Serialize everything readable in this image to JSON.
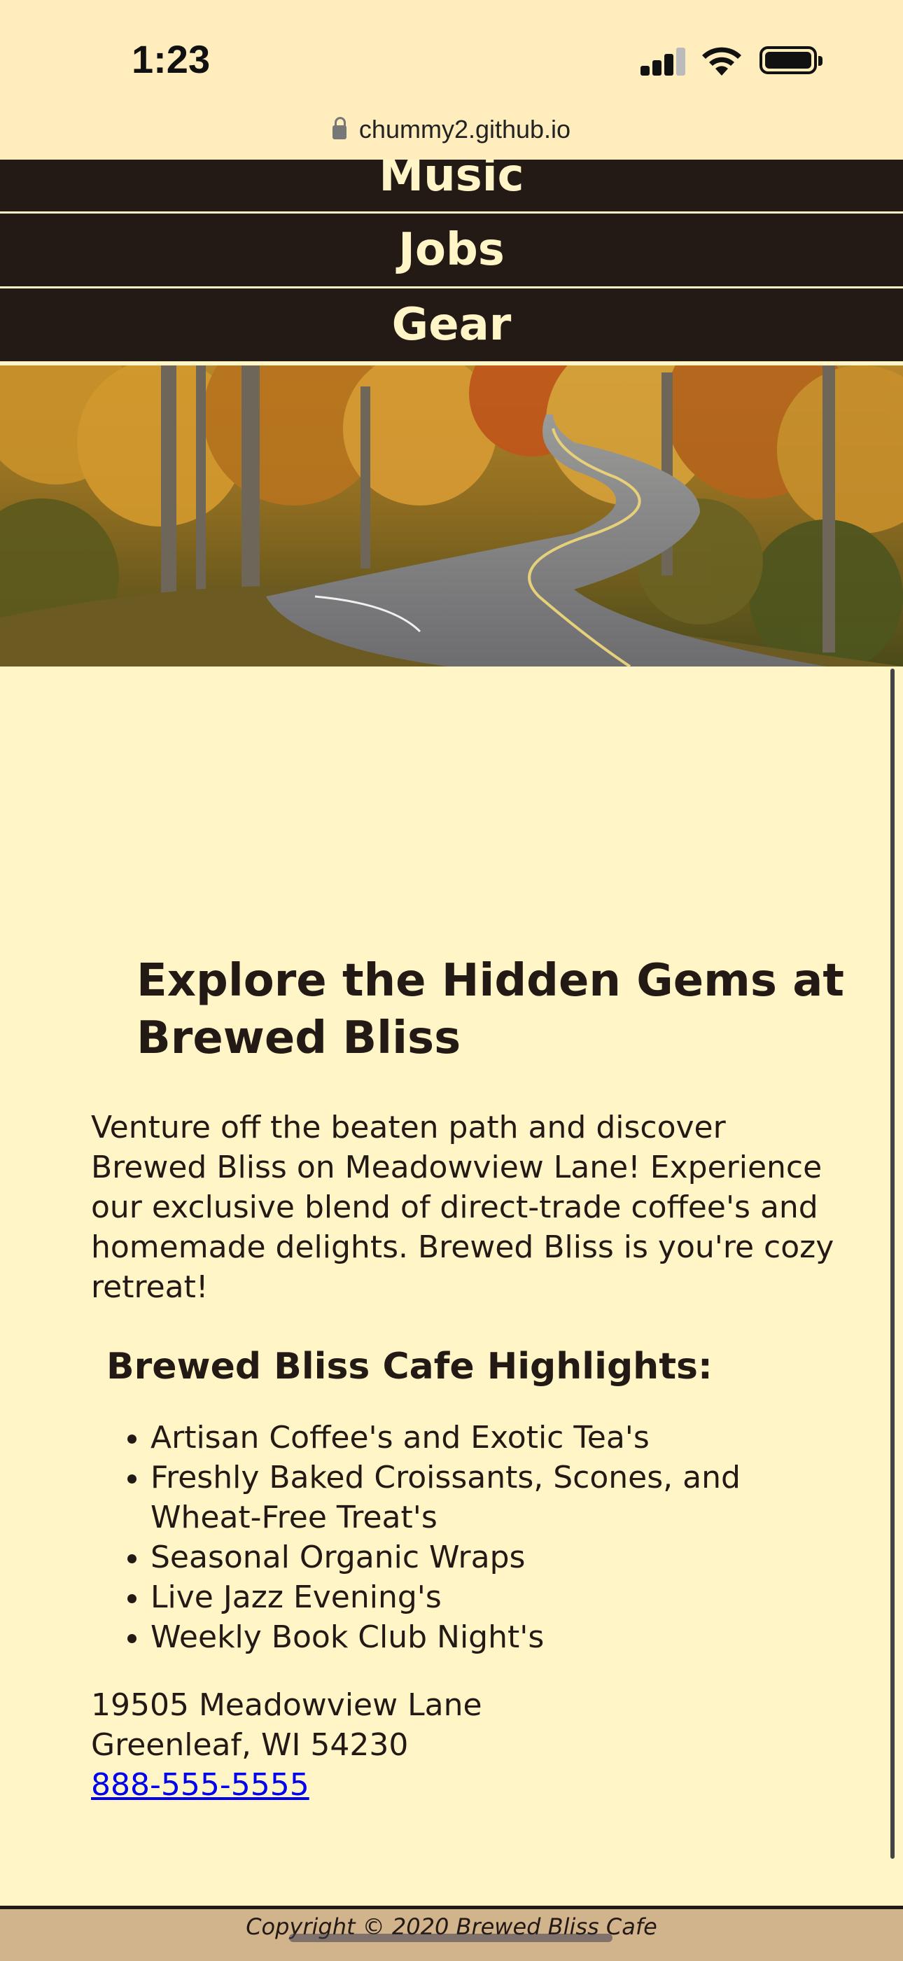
{
  "status_bar": {
    "time": "1:23",
    "icons": [
      "signal-icon",
      "wifi-icon",
      "battery-icon"
    ]
  },
  "browser": {
    "url": "chummy2.github.io",
    "lock_icon": "lock-icon"
  },
  "nav": {
    "items": [
      {
        "label": "Music"
      },
      {
        "label": "Jobs"
      },
      {
        "label": "Gear"
      }
    ]
  },
  "hero": {
    "image": "winding-road-through-autumn-forest"
  },
  "main": {
    "heading": "Explore the Hidden Gems at Brewed Bliss",
    "intro": "Venture off the beaten path and discover Brewed Bliss on Meadowview Lane! Experience our exclusive blend of direct-trade coffee's and homemade delights. Brewed Bliss is you're cozy retreat!",
    "highlights_heading": "Brewed Bliss Cafe Highlights:",
    "highlights": [
      "Artisan Coffee's and Exotic Tea's",
      "Freshly Baked Croissants, Scones, and Wheat-Free Treat's",
      "Seasonal Organic Wraps",
      "Live Jazz Evening's",
      "Weekly Book Club Night's"
    ],
    "address_line1": "19505 Meadowview Lane",
    "address_line2": "Greenleaf, WI 54230",
    "phone": "888-555-5555"
  },
  "footer": {
    "copyright": "Copyright © 2020 Brewed Bliss Cafe"
  },
  "colors": {
    "background": "#FFF5C7",
    "nav_background": "#231915",
    "nav_text": "#FFF5C7",
    "footer_background": "#D2B48C",
    "link": "#0000EE"
  }
}
